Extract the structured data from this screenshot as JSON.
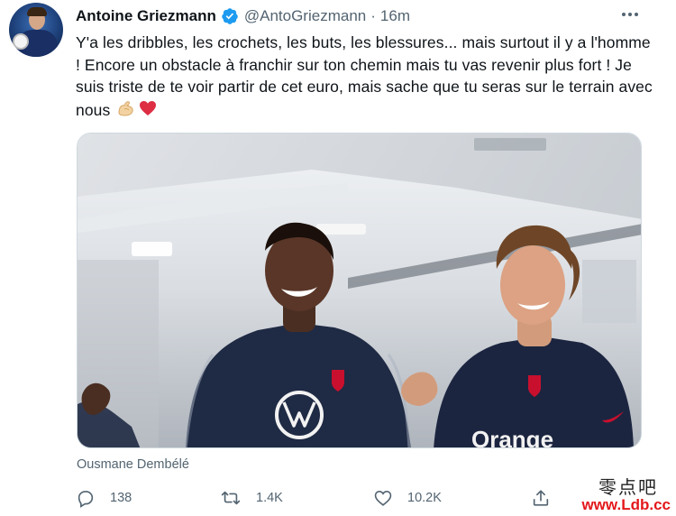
{
  "tweet": {
    "author_name": "Antoine Griezmann",
    "handle": "@AntoGriezmann",
    "separator": "·",
    "time": "16m",
    "text": "Y'a les dribbles, les crochets, les buts, les blessures... mais surtout il y a l'homme ! Encore un obstacle à franchir sur ton chemin mais tu vas revenir plus fort ! Je suis triste de te voir partir de cet euro, mais sache que tu seras sur le terrain avec nous",
    "emojis": [
      "flexed-biceps-icon",
      "red-heart-icon"
    ],
    "media_caption": "Ousmane Dembélé",
    "media_brand_text": "Orange"
  },
  "actions": {
    "reply_count": "138",
    "retweet_count": "1.4K",
    "like_count": "10.2K"
  },
  "watermark": {
    "chinese": "零点吧",
    "url": "www.Ldb.cc"
  },
  "colors": {
    "text_primary": "#0f1419",
    "text_secondary": "#536471",
    "verified_blue": "#1d9bf0",
    "watermark_red": "#e3171b"
  }
}
